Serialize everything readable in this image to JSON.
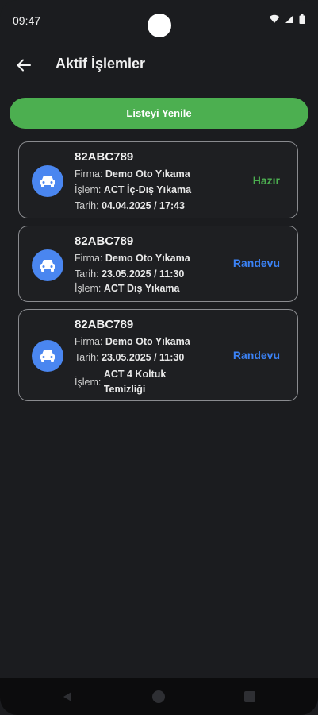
{
  "status_bar": {
    "time": "09:47"
  },
  "app_bar": {
    "title": "Aktif İşlemler"
  },
  "refresh_label": "Listeyi Yenile",
  "colors": {
    "accent_green": "#4caf50",
    "status_blue": "#3b82f6",
    "avatar_blue": "#4a86f0"
  },
  "cards": [
    {
      "plate": "82ABC789",
      "lines": [
        {
          "label": "Firma:",
          "value": "Demo Oto Yıkama"
        },
        {
          "label": "İşlem:",
          "value": "ACT İç-Dış Yıkama"
        },
        {
          "label": "Tarih:",
          "value": "04.04.2025 / 17:43"
        }
      ],
      "status": "Hazır",
      "status_color": "#4caf50",
      "icon": "car-icon"
    },
    {
      "plate": "82ABC789",
      "lines": [
        {
          "label": "Firma:",
          "value": "Demo Oto Yıkama"
        },
        {
          "label": "Tarih:",
          "value": "23.05.2025 / 11:30"
        },
        {
          "label": "İşlem:",
          "value": "ACT Dış Yıkama"
        }
      ],
      "status": "Randevu",
      "status_color": "#3b82f6",
      "icon": "car-icon"
    },
    {
      "plate": "82ABC789",
      "lines": [
        {
          "label": "Firma:",
          "value": "Demo Oto Yıkama"
        },
        {
          "label": "Tarih:",
          "value": "23.05.2025 / 11:30"
        },
        {
          "label": "İşlem:",
          "value": "ACT 4 Koltuk Temizliği"
        }
      ],
      "status": "Randevu",
      "status_color": "#3b82f6",
      "icon": "car-icon"
    }
  ]
}
